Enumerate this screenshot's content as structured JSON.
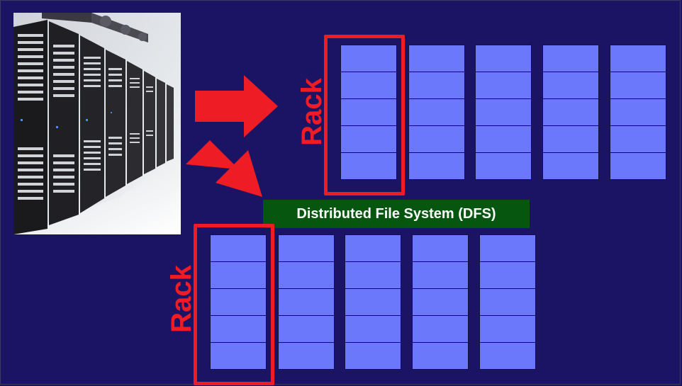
{
  "rack_label": "Rack",
  "dfs_label": "Distributed File System (DFS)",
  "photo": {
    "icon": "server-racks-photo"
  },
  "colors": {
    "background": "#1b1464",
    "node": "#6b78fb",
    "rack_outline": "#ee1c25",
    "dfs": "#06560f"
  },
  "racks": [
    {
      "columns": 5,
      "nodes_per_column": 5
    },
    {
      "columns": 5,
      "nodes_per_column": 5
    }
  ]
}
